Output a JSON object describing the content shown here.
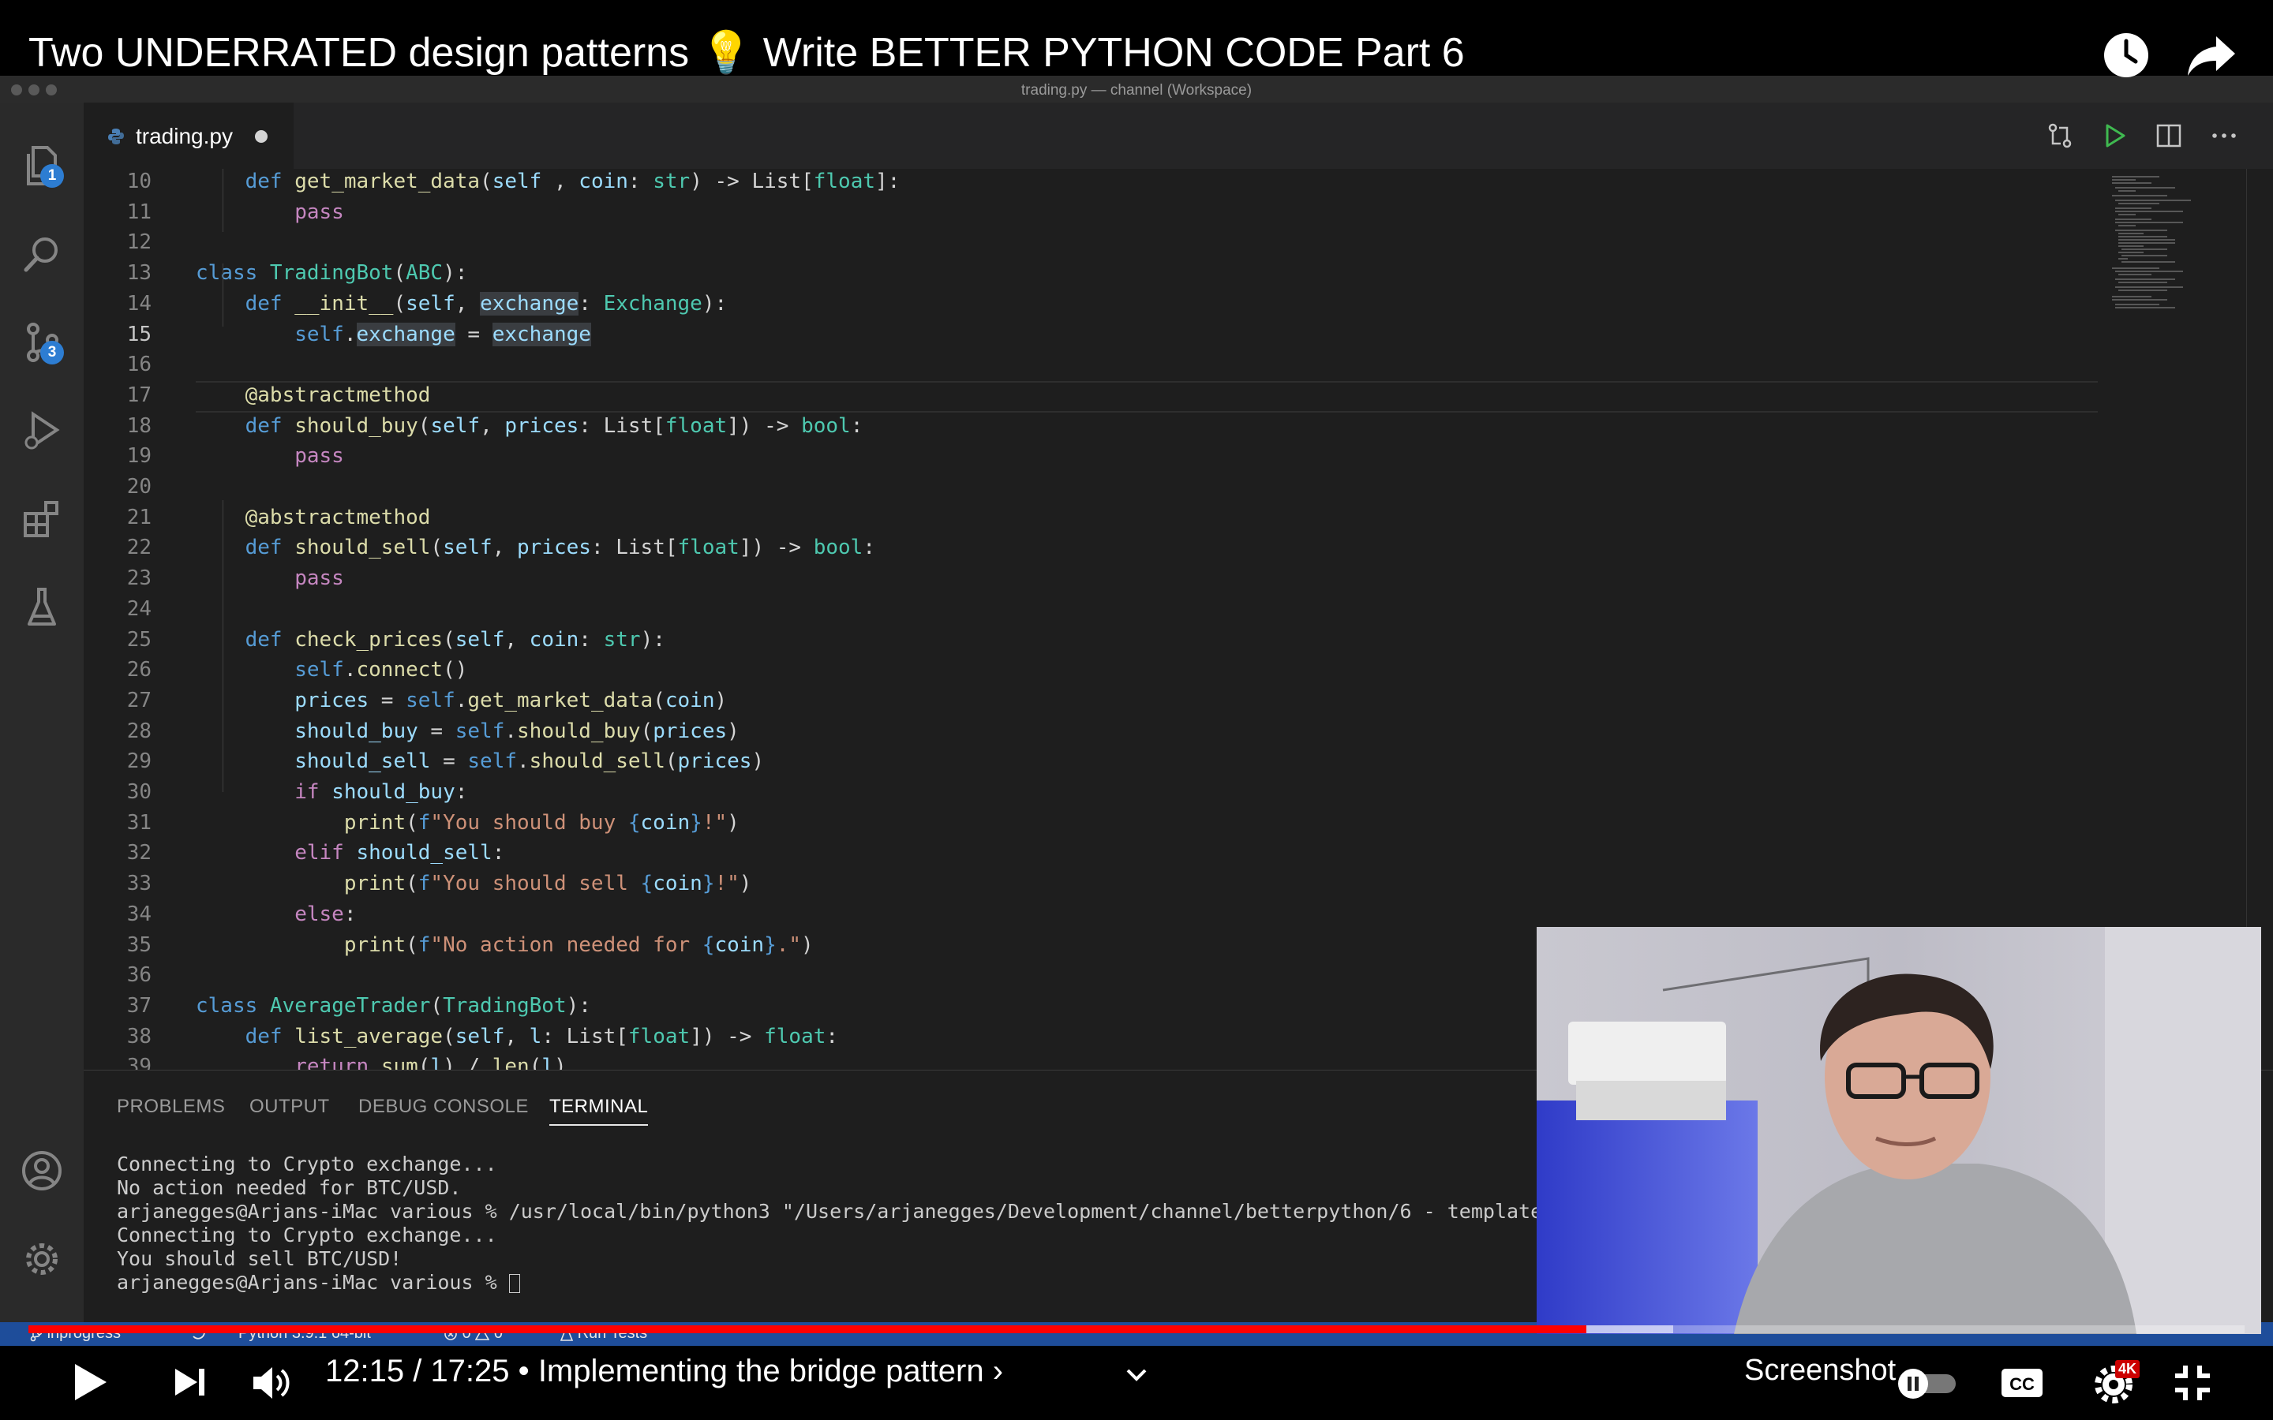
{
  "video": {
    "title_pre": "Two UNDERRATED design patterns ",
    "title_emoji": "💡",
    "title_post": " Write BETTER PYTHON CODE Part 6",
    "time": "12:15 / 17:25",
    "separator": "•",
    "chapter": "Implementing the bridge pattern",
    "chapter_chevron": "›",
    "screenshot_label": "Screenshot",
    "quality_badge": "4K",
    "progress_percent": 70.3,
    "icons": [
      "watch-later-icon",
      "share-icon",
      "play-icon",
      "next-icon",
      "volume-icon",
      "chevron-down-icon",
      "pause-toggle-icon",
      "cc-icon",
      "settings-icon",
      "exit-fullscreen-icon"
    ]
  },
  "window": {
    "title": "trading.py — channel (Workspace)"
  },
  "activity_bar": {
    "explorer_badge": "1",
    "scm_badge": "3"
  },
  "tab": {
    "name": "trading.py"
  },
  "editor": {
    "current_line": "15",
    "lines": [
      {
        "n": "10",
        "segs": [
          [
            "k",
            "    def "
          ],
          [
            "f",
            "get_market_data"
          ],
          [
            "",
            "("
          ],
          [
            "p",
            "self"
          ],
          [
            "",
            " , "
          ],
          [
            "p",
            "coin"
          ],
          [
            "",
            ": "
          ],
          [
            "c",
            "str"
          ],
          [
            "",
            ") -> List["
          ],
          [
            "c",
            "float"
          ],
          [
            "",
            "]:"
          ]
        ]
      },
      {
        "n": "11",
        "segs": [
          [
            "ctrl",
            "        pass"
          ]
        ]
      },
      {
        "n": "12",
        "segs": []
      },
      {
        "n": "13",
        "segs": [
          [
            "k",
            "class "
          ],
          [
            "c",
            "TradingBot"
          ],
          [
            "",
            "("
          ],
          [
            "c",
            "ABC"
          ],
          [
            "",
            "):"
          ]
        ]
      },
      {
        "n": "14",
        "segs": [
          [
            "k",
            "    def "
          ],
          [
            "f",
            "__init__"
          ],
          [
            "",
            "("
          ],
          [
            "p",
            "self"
          ],
          [
            "",
            ", "
          ],
          [
            "p hl",
            "exchange"
          ],
          [
            "",
            ": "
          ],
          [
            "c",
            "Exchange"
          ],
          [
            "",
            "):"
          ]
        ]
      },
      {
        "n": "15",
        "segs": [
          [
            "k",
            "        self"
          ],
          [
            "",
            "."
          ],
          [
            "p hl",
            "exchange"
          ],
          [
            "",
            " = "
          ],
          [
            "p hl",
            "exchange"
          ]
        ]
      },
      {
        "n": "16",
        "segs": []
      },
      {
        "n": "17",
        "segs": [
          [
            "f",
            "    @abstractmethod"
          ]
        ]
      },
      {
        "n": "18",
        "segs": [
          [
            "k",
            "    def "
          ],
          [
            "f",
            "should_buy"
          ],
          [
            "",
            "("
          ],
          [
            "p",
            "self"
          ],
          [
            "",
            ", "
          ],
          [
            "p",
            "prices"
          ],
          [
            "",
            ": List["
          ],
          [
            "c",
            "float"
          ],
          [
            "",
            "]) -> "
          ],
          [
            "c",
            "bool"
          ],
          [
            "",
            ":"
          ]
        ]
      },
      {
        "n": "19",
        "segs": [
          [
            "ctrl",
            "        pass"
          ]
        ]
      },
      {
        "n": "20",
        "segs": []
      },
      {
        "n": "21",
        "segs": [
          [
            "f",
            "    @abstractmethod"
          ]
        ]
      },
      {
        "n": "22",
        "segs": [
          [
            "k",
            "    def "
          ],
          [
            "f",
            "should_sell"
          ],
          [
            "",
            "("
          ],
          [
            "p",
            "self"
          ],
          [
            "",
            ", "
          ],
          [
            "p",
            "prices"
          ],
          [
            "",
            ": List["
          ],
          [
            "c",
            "float"
          ],
          [
            "",
            "]) -> "
          ],
          [
            "c",
            "bool"
          ],
          [
            "",
            ":"
          ]
        ]
      },
      {
        "n": "23",
        "segs": [
          [
            "ctrl",
            "        pass"
          ]
        ]
      },
      {
        "n": "24",
        "segs": []
      },
      {
        "n": "25",
        "segs": [
          [
            "k",
            "    def "
          ],
          [
            "f",
            "check_prices"
          ],
          [
            "",
            "("
          ],
          [
            "p",
            "self"
          ],
          [
            "",
            ", "
          ],
          [
            "p",
            "coin"
          ],
          [
            "",
            ": "
          ],
          [
            "c",
            "str"
          ],
          [
            "",
            "):"
          ]
        ]
      },
      {
        "n": "26",
        "segs": [
          [
            "k",
            "        self"
          ],
          [
            "",
            "."
          ],
          [
            "f",
            "connect"
          ],
          [
            "",
            "()"
          ]
        ]
      },
      {
        "n": "27",
        "segs": [
          [
            "p",
            "        prices"
          ],
          [
            "",
            " = "
          ],
          [
            "k",
            "self"
          ],
          [
            "",
            "."
          ],
          [
            "f",
            "get_market_data"
          ],
          [
            "",
            "("
          ],
          [
            "p",
            "coin"
          ],
          [
            "",
            ")"
          ]
        ]
      },
      {
        "n": "28",
        "segs": [
          [
            "p",
            "        should_buy"
          ],
          [
            "",
            " = "
          ],
          [
            "k",
            "self"
          ],
          [
            "",
            "."
          ],
          [
            "f",
            "should_buy"
          ],
          [
            "",
            "("
          ],
          [
            "p",
            "prices"
          ],
          [
            "",
            ")"
          ]
        ]
      },
      {
        "n": "29",
        "segs": [
          [
            "p",
            "        should_sell"
          ],
          [
            "",
            " = "
          ],
          [
            "k",
            "self"
          ],
          [
            "",
            "."
          ],
          [
            "f",
            "should_sell"
          ],
          [
            "",
            "("
          ],
          [
            "p",
            "prices"
          ],
          [
            "",
            ")"
          ]
        ]
      },
      {
        "n": "30",
        "segs": [
          [
            "ctrl",
            "        if "
          ],
          [
            "p",
            "should_buy"
          ],
          [
            "",
            ":"
          ]
        ]
      },
      {
        "n": "31",
        "segs": [
          [
            "f",
            "            print"
          ],
          [
            "",
            "("
          ],
          [
            "k",
            "f"
          ],
          [
            "s",
            "\"You should buy "
          ],
          [
            "k",
            "{"
          ],
          [
            "p",
            "coin"
          ],
          [
            "k",
            "}"
          ],
          [
            "s",
            "!\""
          ],
          [
            "",
            ")"
          ]
        ]
      },
      {
        "n": "32",
        "segs": [
          [
            "ctrl",
            "        elif "
          ],
          [
            "p",
            "should_sell"
          ],
          [
            "",
            ":"
          ]
        ]
      },
      {
        "n": "33",
        "segs": [
          [
            "f",
            "            print"
          ],
          [
            "",
            "("
          ],
          [
            "k",
            "f"
          ],
          [
            "s",
            "\"You should sell "
          ],
          [
            "k",
            "{"
          ],
          [
            "p",
            "coin"
          ],
          [
            "k",
            "}"
          ],
          [
            "s",
            "!\""
          ],
          [
            "",
            ")"
          ]
        ]
      },
      {
        "n": "34",
        "segs": [
          [
            "ctrl",
            "        else"
          ],
          [
            "",
            ":"
          ]
        ]
      },
      {
        "n": "35",
        "segs": [
          [
            "f",
            "            print"
          ],
          [
            "",
            "("
          ],
          [
            "k",
            "f"
          ],
          [
            "s",
            "\"No action needed for "
          ],
          [
            "k",
            "{"
          ],
          [
            "p",
            "coin"
          ],
          [
            "k",
            "}"
          ],
          [
            "s",
            ".\""
          ],
          [
            "",
            ")"
          ]
        ]
      },
      {
        "n": "36",
        "segs": []
      },
      {
        "n": "37",
        "segs": [
          [
            "k",
            "class "
          ],
          [
            "c",
            "AverageTrader"
          ],
          [
            "",
            "("
          ],
          [
            "c",
            "TradingBot"
          ],
          [
            "",
            "):"
          ]
        ]
      },
      {
        "n": "38",
        "segs": [
          [
            "k",
            "    def "
          ],
          [
            "f",
            "list_average"
          ],
          [
            "",
            "("
          ],
          [
            "p",
            "self"
          ],
          [
            "",
            ", "
          ],
          [
            "p",
            "l"
          ],
          [
            "",
            ": List["
          ],
          [
            "c",
            "float"
          ],
          [
            "",
            "]) -> "
          ],
          [
            "c",
            "float"
          ],
          [
            "",
            ":"
          ]
        ]
      },
      {
        "n": "39",
        "segs": [
          [
            "ctrl",
            "        return "
          ],
          [
            "f",
            "sum"
          ],
          [
            "",
            "("
          ],
          [
            "p",
            "l"
          ],
          [
            "",
            ") / "
          ],
          [
            "f",
            "len"
          ],
          [
            "",
            "("
          ],
          [
            "p",
            "l"
          ],
          [
            "",
            ")"
          ]
        ]
      }
    ]
  },
  "panel": {
    "tabs": [
      "PROBLEMS",
      "OUTPUT",
      "DEBUG CONSOLE",
      "TERMINAL"
    ],
    "active_tab": "TERMINAL",
    "terminal_lines": [
      "Connecting to Crypto exchange...",
      "No action needed for BTC/USD.",
      "arjanegges@Arjans-iMac various % /usr/local/bin/python3 \"/Users/arjanegges/Development/channel/betterpython/6 - template",
      "Connecting to Crypto exchange...",
      "You should sell BTC/USD!",
      "arjanegges@Arjans-iMac various % "
    ]
  },
  "statusbar": {
    "branch": "inprogress*",
    "python": "Python 3.9.1 64-bit",
    "errors": "0",
    "warnings": "0",
    "run_tests": "Run Tests"
  },
  "colors": {
    "keyword": "#569cd6",
    "class": "#4ec9b0",
    "function": "#dcdcaa",
    "param": "#9cdcfe",
    "string": "#ce9178",
    "control": "#c586c0",
    "progress": "#ff0000",
    "statusbar": "#1e4d9a"
  }
}
